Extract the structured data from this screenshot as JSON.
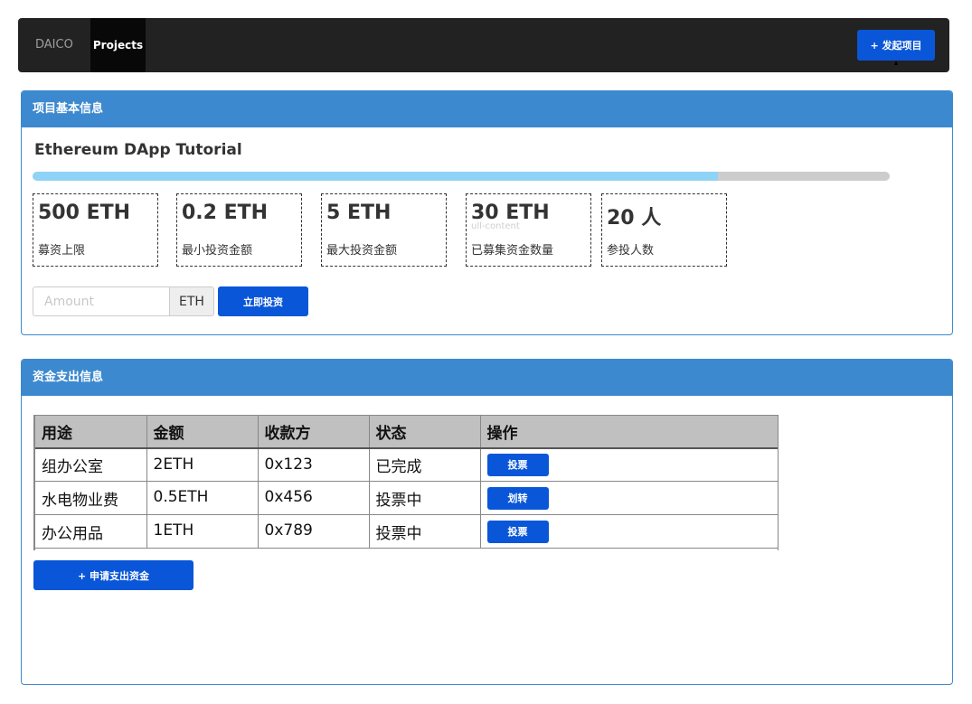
{
  "navbar": {
    "brand": "DAICO",
    "active_item": "Projects",
    "create_button": "+ 发起项目"
  },
  "project_panel": {
    "heading": "项目基本信息",
    "title": "Ethereum DApp Tutorial",
    "progress_fraction": 0.8,
    "stats": [
      {
        "value": "500 ETH",
        "label": "募资上限"
      },
      {
        "value": "0.2 ETH",
        "label": "最小投资金额"
      },
      {
        "value": "5 ETH",
        "label": "最大投资金额"
      },
      {
        "value": "30 ETH",
        "label": "已募集资金数量"
      },
      {
        "value": "20 人",
        "label": "参投人数"
      }
    ],
    "ghost_text": "ull-content",
    "amount_placeholder": "Amount",
    "amount_unit": "ETH",
    "invest_button": "立即投资"
  },
  "spending_panel": {
    "heading": "资金支出信息",
    "columns": [
      "用途",
      "金额",
      "收款方",
      "状态",
      "操作"
    ],
    "rows": [
      {
        "purpose": "组办公室",
        "amount": "2ETH",
        "payee": "0x123",
        "status": "已完成",
        "action": "投票"
      },
      {
        "purpose": "水电物业费",
        "amount": "0.5ETH",
        "payee": "0x456",
        "status": "投票中",
        "action": "划转"
      },
      {
        "purpose": "办公用品",
        "amount": "1ETH",
        "payee": "0x789",
        "status": "投票中",
        "action": "投票"
      }
    ],
    "apply_button": "+ 申请支出资金"
  },
  "colors": {
    "navbar_bg": "#222222",
    "panel_primary": "#3d89cf",
    "button_primary": "#0a56d8",
    "progress_fill": "#8fd3f6",
    "progress_track": "#cccccc"
  }
}
